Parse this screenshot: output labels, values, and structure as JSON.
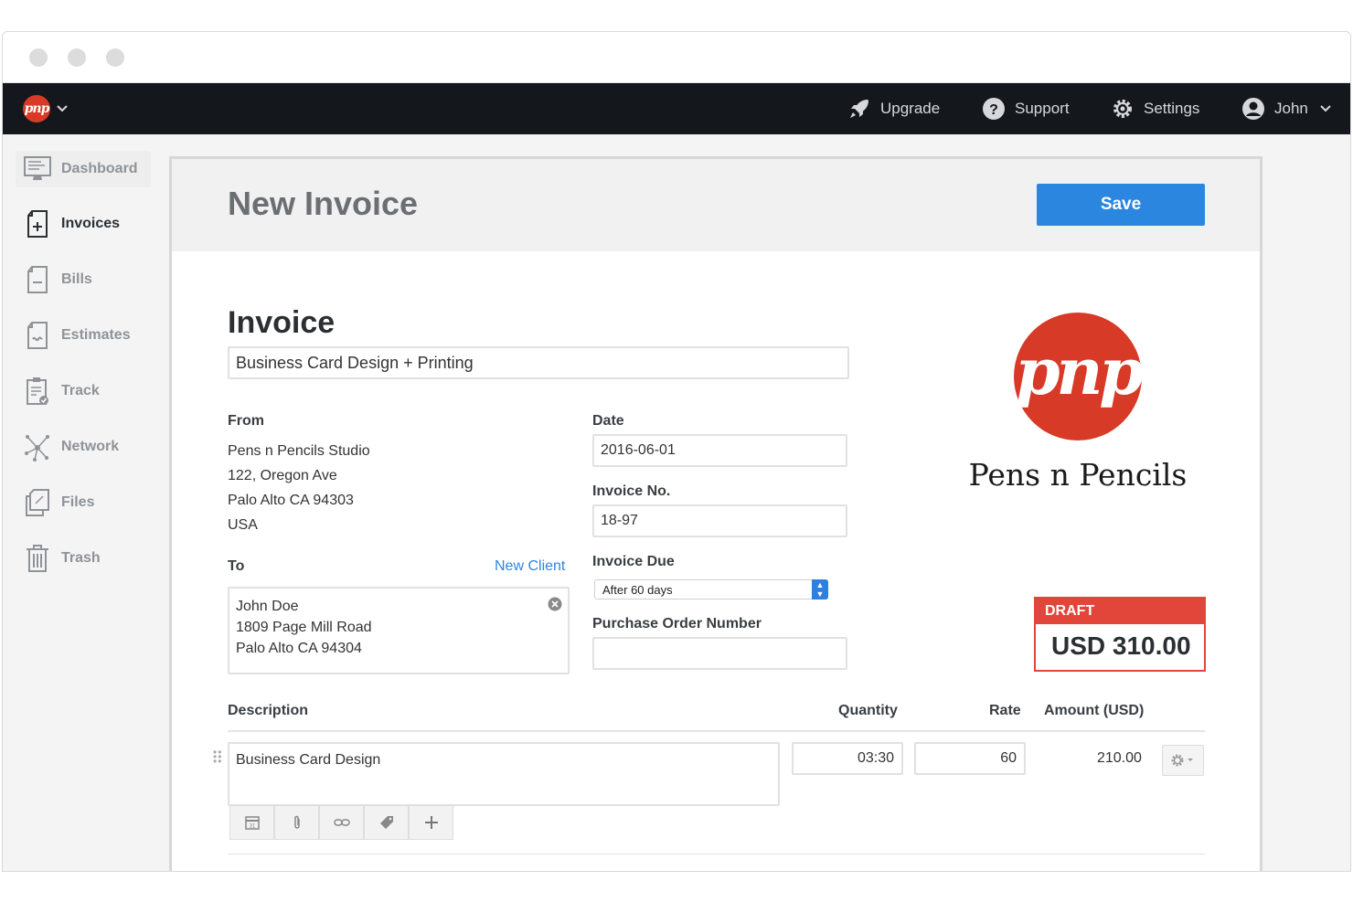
{
  "nav": {
    "brand": "pnp",
    "upgrade": "Upgrade",
    "support": "Support",
    "settings": "Settings",
    "user": "John"
  },
  "sidebar": {
    "items": [
      {
        "label": "Dashboard",
        "icon": "monitor-icon"
      },
      {
        "label": "Invoices",
        "icon": "invoice-plus-icon"
      },
      {
        "label": "Bills",
        "icon": "bill-minus-icon"
      },
      {
        "label": "Estimates",
        "icon": "estimate-icon"
      },
      {
        "label": "Track",
        "icon": "clipboard-check-icon"
      },
      {
        "label": "Network",
        "icon": "network-icon"
      },
      {
        "label": "Files",
        "icon": "files-icon"
      },
      {
        "label": "Trash",
        "icon": "trash-icon"
      }
    ],
    "active": "Invoices"
  },
  "page": {
    "title": "New Invoice",
    "save_label": "Save"
  },
  "invoice": {
    "heading": "Invoice",
    "subject": "Business Card Design + Printing",
    "from_label": "From",
    "from_lines": [
      "Pens n Pencils Studio",
      "122, Oregon Ave",
      "Palo Alto CA 94303",
      "USA"
    ],
    "to_label": "To",
    "new_client": "New Client",
    "to_lines": [
      "John Doe",
      "1809 Page Mill Road",
      "Palo Alto CA 94304"
    ],
    "date_label": "Date",
    "date": "2016-06-01",
    "number_label": "Invoice No.",
    "number": "18-97",
    "due_label": "Invoice Due",
    "due": "After 60 days",
    "po_label": "Purchase Order Number",
    "po": ""
  },
  "company": {
    "logo_text": "pnp",
    "name": "Pens n Pencils"
  },
  "status": {
    "label": "DRAFT",
    "amount": "USD 310.00"
  },
  "items": {
    "headers": {
      "description": "Description",
      "quantity": "Quantity",
      "rate": "Rate",
      "amount": "Amount (USD)"
    },
    "rows": [
      {
        "description": "Business Card Design",
        "quantity": "03:30",
        "rate": "60",
        "amount": "210.00"
      }
    ]
  },
  "colors": {
    "accent": "#2b86e0",
    "brand": "#d83a28",
    "draft": "#e2463a",
    "nav_bg": "#14171c"
  }
}
